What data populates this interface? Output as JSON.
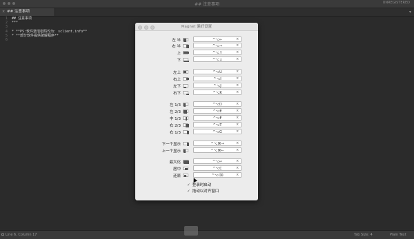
{
  "window": {
    "title": "## 注意事项",
    "status_right": "UNREGISTERED"
  },
  "tab": {
    "label": "## 注意事项",
    "close": "×"
  },
  "editor": {
    "line_numbers": [
      "1",
      "2",
      "3",
      "4",
      "5",
      "6"
    ],
    "lines": [
      "## 注意事项",
      "***",
      "",
      "* **PS:软件激活密码均为: sclient.info**",
      "* **部分软件提供破解程序**",
      ""
    ]
  },
  "statusbar": {
    "position": "Line 6, Column 17",
    "tab_size": "Tab Size: 4",
    "syntax": "Plain Text"
  },
  "magnet": {
    "title": "Magnet 偏好设置",
    "rows": [
      {
        "label": "左 半",
        "shortcut": "^⌥←"
      },
      {
        "label": "右 半",
        "shortcut": "^⌥→"
      },
      {
        "label": "上",
        "shortcut": "^⌥↑"
      },
      {
        "label": "下",
        "shortcut": "^⌥↓"
      },
      {
        "label": "左上",
        "shortcut": "^⌥U"
      },
      {
        "label": "右上",
        "shortcut": "^⌥I"
      },
      {
        "label": "左下",
        "shortcut": "^⌥J"
      },
      {
        "label": "右下",
        "shortcut": "^⌥K"
      },
      {
        "label": "左 1/3",
        "shortcut": "^⌥D"
      },
      {
        "label": "左 2/3",
        "shortcut": "^⌥E"
      },
      {
        "label": "中 1/3",
        "shortcut": "^⌥F"
      },
      {
        "label": "右 2/3",
        "shortcut": "^⌥T"
      },
      {
        "label": "右 1/3",
        "shortcut": "^⌥G"
      },
      {
        "label": "下一个显示",
        "shortcut": "^⌥⌘→"
      },
      {
        "label": "上一个显示",
        "shortcut": "^⌥⌘←"
      },
      {
        "label": "最大化",
        "shortcut": "^⌥↩"
      },
      {
        "label": "居中",
        "shortcut": "^⌥C"
      },
      {
        "label": "还原",
        "shortcut": "^⌥⌫"
      }
    ],
    "clear": "×",
    "checks": [
      {
        "mark": "✓",
        "label": "登录时启动"
      },
      {
        "mark": "✓",
        "label": "拖动以对齐窗口"
      }
    ]
  }
}
